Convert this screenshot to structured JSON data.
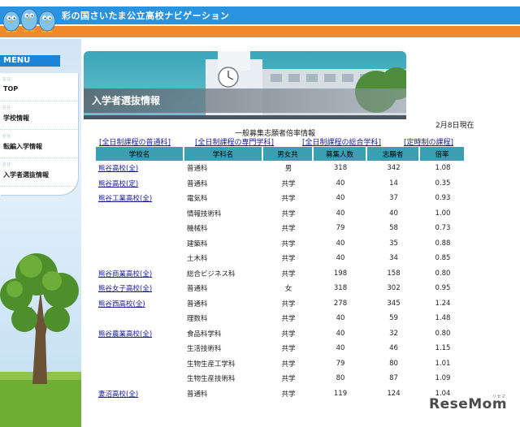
{
  "header": {
    "site_title": "彩の国さいたま公立高校ナビゲーション"
  },
  "sidebar": {
    "menu_label": "MENU",
    "items": [
      {
        "label": "TOP"
      },
      {
        "label": "学校情報"
      },
      {
        "label": "転編入学情報"
      },
      {
        "label": "入学者選抜情報"
      }
    ]
  },
  "banner": {
    "title": "入学者選抜情報"
  },
  "main": {
    "as_of": "2月8日現在",
    "subtitle": "一般募集志願者倍率情報",
    "category_links": [
      "[全日制課程の普通科]",
      "[全日制課程の専門学科]",
      "[全日制課程の総合学科]",
      "[定時制の課程]"
    ],
    "table": {
      "headers": [
        "学校名",
        "学科名",
        "男女共",
        "募集人数",
        "志願者",
        "倍率"
      ],
      "rows": [
        {
          "school": "熊谷高校(全)",
          "dept": "普通科",
          "gender": "男",
          "quota": "318",
          "applicants": "342",
          "ratio": "1.08"
        },
        {
          "school": "熊谷高校(定)",
          "dept": "普通科",
          "gender": "共学",
          "quota": "40",
          "applicants": "14",
          "ratio": "0.35"
        },
        {
          "school": "熊谷工業高校(全)",
          "dept": "電気科",
          "gender": "共学",
          "quota": "40",
          "applicants": "37",
          "ratio": "0.93"
        },
        {
          "school": "",
          "dept": "情報技術科",
          "gender": "共学",
          "quota": "40",
          "applicants": "40",
          "ratio": "1.00"
        },
        {
          "school": "",
          "dept": "機械科",
          "gender": "共学",
          "quota": "79",
          "applicants": "58",
          "ratio": "0.73"
        },
        {
          "school": "",
          "dept": "建築科",
          "gender": "共学",
          "quota": "40",
          "applicants": "35",
          "ratio": "0.88"
        },
        {
          "school": "",
          "dept": "土木科",
          "gender": "共学",
          "quota": "40",
          "applicants": "34",
          "ratio": "0.85"
        },
        {
          "school": "熊谷商業高校(全)",
          "dept": "総合ビジネス科",
          "gender": "共学",
          "quota": "198",
          "applicants": "158",
          "ratio": "0.80"
        },
        {
          "school": "熊谷女子高校(全)",
          "dept": "普通科",
          "gender": "女",
          "quota": "318",
          "applicants": "302",
          "ratio": "0.95"
        },
        {
          "school": "熊谷西高校(全)",
          "dept": "普通科",
          "gender": "共学",
          "quota": "278",
          "applicants": "345",
          "ratio": "1.24"
        },
        {
          "school": "",
          "dept": "理数科",
          "gender": "共学",
          "quota": "40",
          "applicants": "59",
          "ratio": "1.48"
        },
        {
          "school": "熊谷農業高校(全)",
          "dept": "食品科学科",
          "gender": "共学",
          "quota": "40",
          "applicants": "32",
          "ratio": "0.80"
        },
        {
          "school": "",
          "dept": "生活技術科",
          "gender": "共学",
          "quota": "40",
          "applicants": "46",
          "ratio": "1.15"
        },
        {
          "school": "",
          "dept": "生物生産工学科",
          "gender": "共学",
          "quota": "79",
          "applicants": "80",
          "ratio": "1.01"
        },
        {
          "school": "",
          "dept": "生物生産技術科",
          "gender": "共学",
          "quota": "80",
          "applicants": "87",
          "ratio": "1.09"
        },
        {
          "school": "妻沼高校(全)",
          "dept": "普通科",
          "gender": "共学",
          "quota": "119",
          "applicants": "124",
          "ratio": "1.04"
        }
      ]
    }
  },
  "watermark": {
    "text": "ReseMom",
    "sub": "リセマム"
  },
  "colors": {
    "header_blue": "#2a93df",
    "header_orange": "#f08a2c",
    "table_header": "#3b9fb4",
    "link": "#1a1a9c"
  },
  "icons": [
    "mascot-birds-icon",
    "clock-tower-image",
    "tree-image"
  ]
}
